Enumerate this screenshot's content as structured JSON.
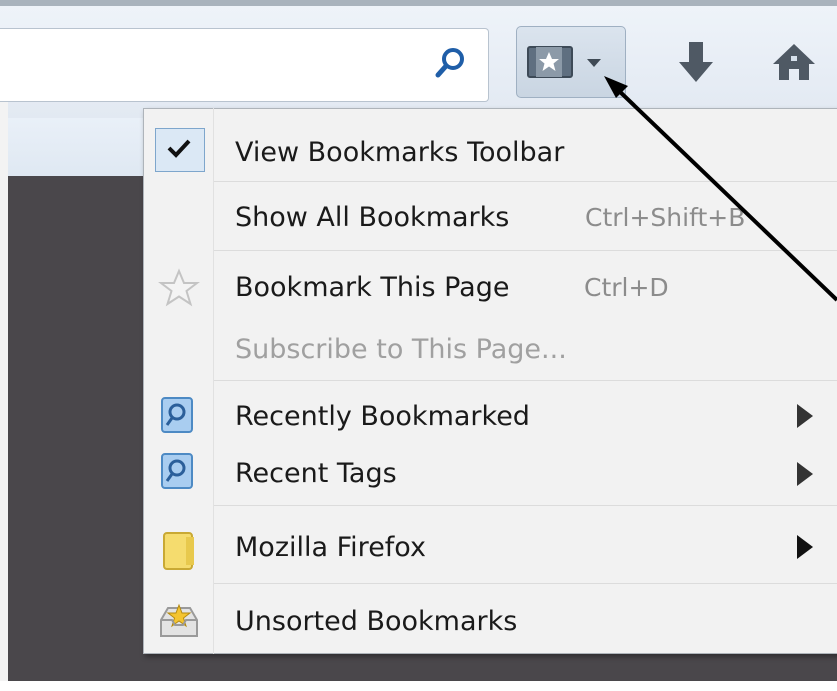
{
  "toolbar": {
    "search_icon": "search-icon",
    "bookmarks_button_icon": "bookmarks-menu-icon",
    "download_icon": "download-arrow-icon",
    "home_icon": "home-icon"
  },
  "menu": {
    "items": [
      {
        "label": "View Bookmarks Toolbar",
        "checked": true,
        "icon": "check-icon"
      },
      {
        "label": "Show All Bookmarks",
        "shortcut": "Ctrl+Shift+B"
      },
      {
        "label": "Bookmark This Page",
        "shortcut": "Ctrl+D",
        "icon": "star-outline-icon"
      },
      {
        "label": "Subscribe to This Page...",
        "disabled": true
      },
      {
        "label": "Recently Bookmarked",
        "icon": "smart-folder-icon",
        "submenu": true
      },
      {
        "label": "Recent Tags",
        "icon": "smart-folder-icon",
        "submenu": true
      },
      {
        "label": "Mozilla Firefox",
        "icon": "folder-icon",
        "submenu": true
      },
      {
        "label": "Unsorted Bookmarks",
        "icon": "unsorted-bookmarks-icon"
      }
    ]
  },
  "colors": {
    "accent": "#7ea6cc",
    "menu_bg": "#f2f2f2",
    "page_dark": "#4a474b",
    "annotation": "#000000"
  }
}
